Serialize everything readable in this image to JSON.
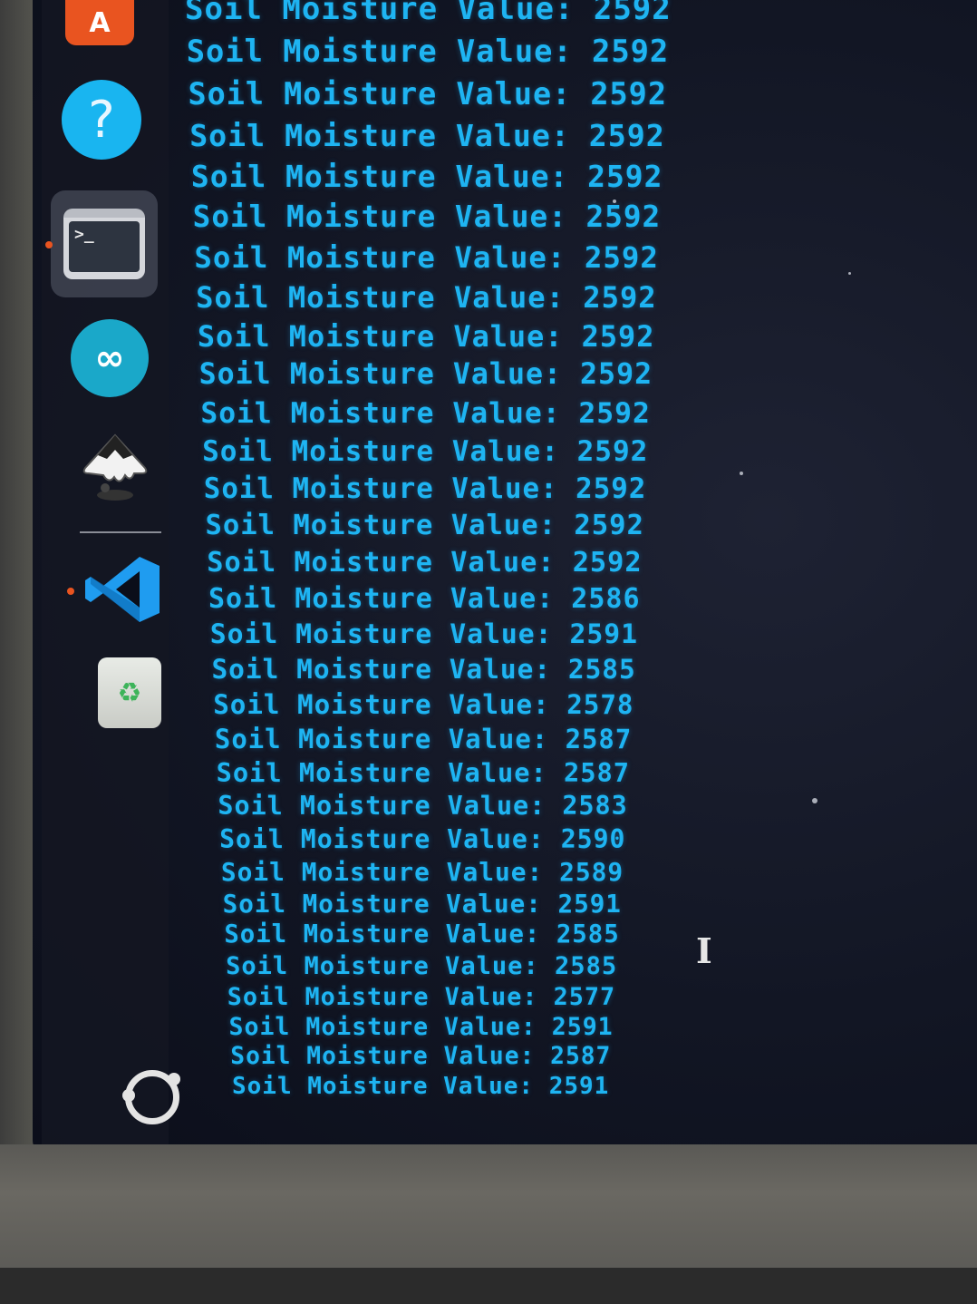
{
  "dock": {
    "items": [
      {
        "name": "app-center",
        "glyph": "A"
      },
      {
        "name": "help",
        "glyph": "?"
      },
      {
        "name": "terminal",
        "glyph": ">_"
      },
      {
        "name": "arduino-ide",
        "glyph": "∞"
      },
      {
        "name": "inkscape"
      },
      {
        "name": "visual-studio-code"
      },
      {
        "name": "trash",
        "glyph": "♻"
      },
      {
        "name": "show-applications"
      }
    ],
    "active_color": "#e95420"
  },
  "terminal": {
    "label": "Soil Moisture Value:",
    "text_color": "#1eb4f2",
    "values": [
      2592,
      2592,
      2592,
      2592,
      2592,
      2592,
      2592,
      2592,
      2592,
      2592,
      2592,
      2592,
      2592,
      2592,
      2592,
      2586,
      2591,
      2585,
      2578,
      2587,
      2587,
      2583,
      2590,
      2589,
      2591,
      2585,
      2585,
      2577,
      2591,
      2587,
      2591
    ],
    "cursor": "I"
  }
}
